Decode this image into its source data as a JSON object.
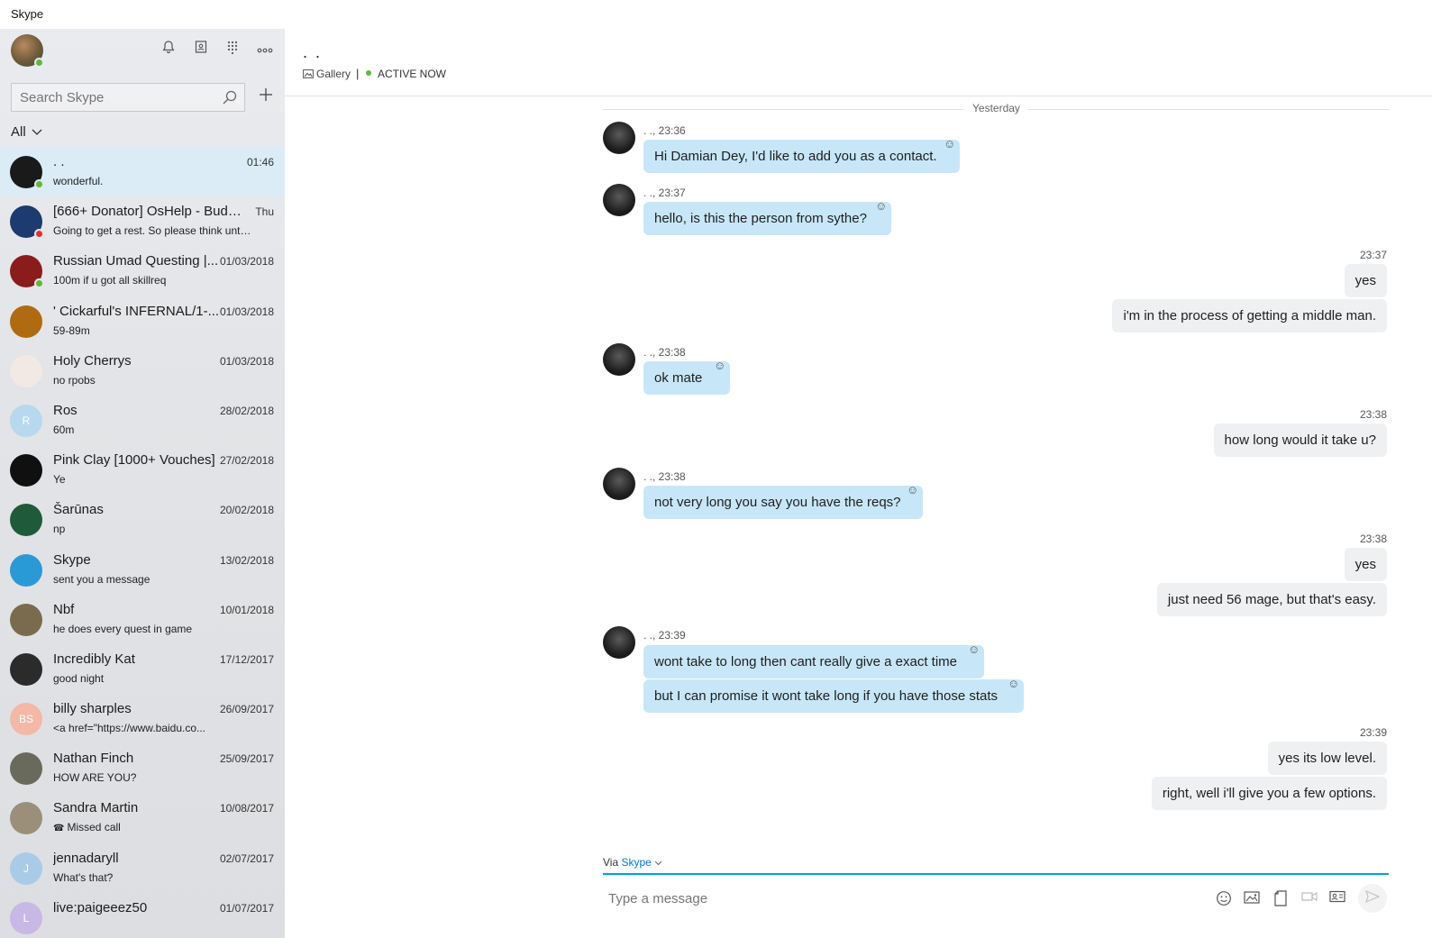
{
  "window": {
    "title": "Skype"
  },
  "sidebar": {
    "search_placeholder": "Search Skype",
    "filter_label": "All",
    "conversations": [
      {
        "name": ". .",
        "time": "01:46",
        "preview": "wonderful.",
        "avatar_color": "#1a1a1a",
        "avatar_text": "",
        "presence": "#5fb83a",
        "active": true
      },
      {
        "name": "[666+ Donator] OsHelp - Budd...",
        "time": "Thu",
        "preview": "Going to get a rest. So please think unti...",
        "avatar_color": "#1c3b6e",
        "avatar_text": "",
        "presence": "#e0302b"
      },
      {
        "name": "Russian Umad Questing |...",
        "time": "01/03/2018",
        "preview": "100m if u got all skillreq",
        "avatar_color": "#8b1c1c",
        "avatar_text": "",
        "presence": "#5fb83a"
      },
      {
        "name": "' Cickarful's INFERNAL/1-...",
        "time": "01/03/2018",
        "preview": "59-89m",
        "avatar_color": "#b06a10",
        "avatar_text": ""
      },
      {
        "name": "Holy Cherrys",
        "time": "01/03/2018",
        "preview": "no rpobs",
        "avatar_color": "#f2e9e4",
        "avatar_text": ""
      },
      {
        "name": "Ros",
        "time": "28/02/2018",
        "preview": "60m",
        "avatar_color": "#b7d8ef",
        "avatar_text": "R"
      },
      {
        "name": "Pink Clay [1000+ Vouches]",
        "time": "27/02/2018",
        "preview": "Ye",
        "avatar_color": "#101010",
        "avatar_text": ""
      },
      {
        "name": "Šarūnas",
        "time": "20/02/2018",
        "preview": "np",
        "avatar_color": "#1f5a3a",
        "avatar_text": ""
      },
      {
        "name": "Skype",
        "time": "13/02/2018",
        "preview": "sent you a message",
        "avatar_color": "#2a9ad6",
        "avatar_text": ""
      },
      {
        "name": "Nbf",
        "time": "10/01/2018",
        "preview": "he does every quest in game",
        "avatar_color": "#7a6b4e",
        "avatar_text": ""
      },
      {
        "name": "Incredibly Kat",
        "time": "17/12/2017",
        "preview": "good night",
        "avatar_color": "#2b2b2b",
        "avatar_text": ""
      },
      {
        "name": "billy sharples",
        "time": "26/09/2017",
        "preview": "<a href=\"https://www.baidu.co...",
        "avatar_color": "#f3b8a6",
        "avatar_text": "BS"
      },
      {
        "name": "Nathan Finch",
        "time": "25/09/2017",
        "preview": "HOW ARE YOU?",
        "avatar_color": "#6a6a5c",
        "avatar_text": ""
      },
      {
        "name": "Sandra Martin",
        "time": "10/08/2017",
        "preview": "Missed call",
        "avatar_color": "#9b8f7a",
        "avatar_text": ""
      },
      {
        "name": "jennadaryll",
        "time": "02/07/2017",
        "preview": "What's that?",
        "avatar_color": "#a9cbe8",
        "avatar_text": "J"
      },
      {
        "name": "live:paigeeez50",
        "time": "01/07/2017",
        "preview": "",
        "avatar_color": "#c8b8e6",
        "avatar_text": "L"
      }
    ]
  },
  "chat": {
    "title": ". .",
    "gallery_label": "Gallery",
    "separator": "|",
    "status_label": "ACTIVE NOW",
    "day_label": "Yesterday",
    "messages": [
      {
        "meta": ". ., 23:36",
        "text": "Hi Damian Dey, I'd like to add you as a contact."
      },
      {
        "meta": ". ., 23:37",
        "text": "hello, is this the person from sythe?"
      },
      {
        "meta": "23:37",
        "text": "yes"
      },
      {
        "text": "i'm in the process of getting a middle man."
      },
      {
        "meta": ". ., 23:38",
        "text": "ok mate"
      },
      {
        "meta": "23:38",
        "text": "how long would it take u?"
      },
      {
        "meta": ". ., 23:38",
        "text": "not very long you say you have the reqs?"
      },
      {
        "meta": "23:38",
        "text": "yes"
      },
      {
        "text": "just need 56 mage, but that's easy."
      },
      {
        "meta": ". ., 23:39",
        "text": "wont take to long then cant really give a exact time"
      },
      {
        "text": "but I can promise it wont take long if you have those stats"
      },
      {
        "meta": "23:39",
        "text": "yes its low level."
      },
      {
        "text": "right, well i'll give you a few options."
      }
    ]
  },
  "composer": {
    "via_prefix": "Via",
    "via_service": "Skype",
    "placeholder": "Type a message"
  },
  "colors": {
    "incoming_bubble": "#c7e7f8",
    "outgoing_bubble": "#eef0f2",
    "accent": "#00a2d6",
    "online": "#5fb83a"
  },
  "icons": [
    "bell-icon",
    "contacts-icon",
    "dialpad-icon",
    "more-icon",
    "search-icon",
    "plus-icon",
    "emoji-icon",
    "image-icon",
    "file-icon",
    "video-message-icon",
    "contact-card-icon",
    "send-icon"
  ]
}
